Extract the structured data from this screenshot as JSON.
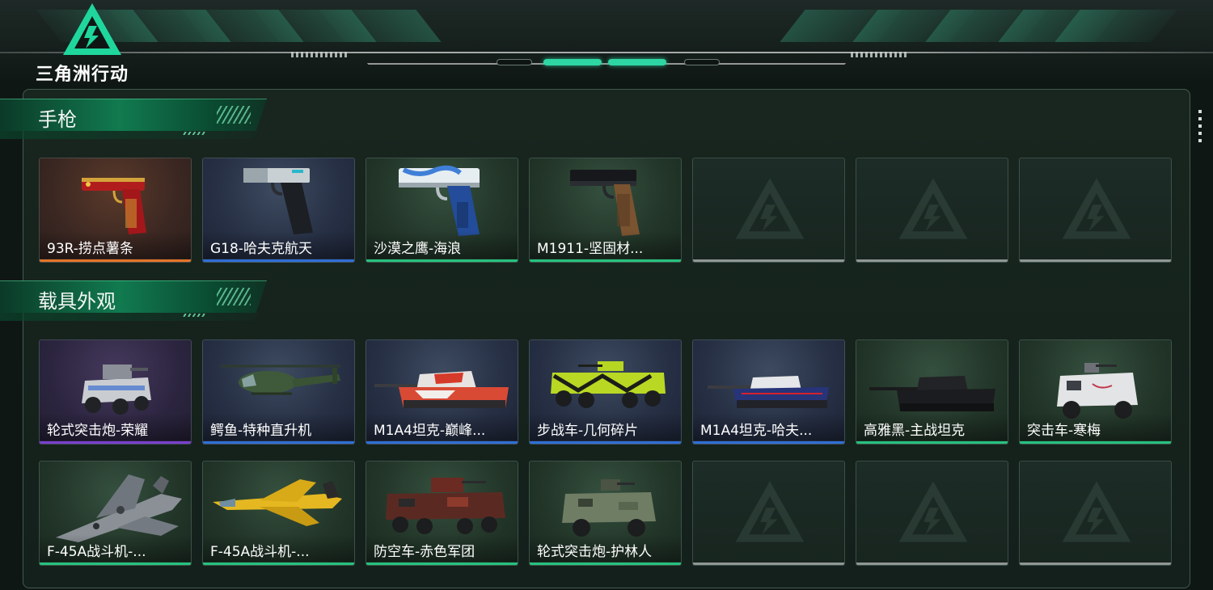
{
  "header": {
    "logo_text": "三角洲行动"
  },
  "sections": [
    {
      "title": "手枪",
      "items": [
        {
          "label": "93R-捞点薯条",
          "rarity": "orange",
          "bg": "orange",
          "icon": "pistol-93r-icon"
        },
        {
          "label": "G18-哈夫克航天",
          "rarity": "blue",
          "bg": "blue",
          "icon": "pistol-g18-icon"
        },
        {
          "label": "沙漠之鹰-海浪",
          "rarity": "green",
          "bg": "green",
          "icon": "pistol-deagle-icon"
        },
        {
          "label": "M1911-坚固材...",
          "rarity": "green",
          "bg": "green",
          "icon": "pistol-m1911-icon"
        }
      ],
      "empty_slots": 3
    },
    {
      "title": "载具外观",
      "items": [
        {
          "label": "轮式突击炮-荣耀",
          "rarity": "purple",
          "bg": "purple",
          "icon": "armored-car-icon"
        },
        {
          "label": "鳄鱼-特种直升机",
          "rarity": "blue",
          "bg": "blue",
          "icon": "helicopter-icon"
        },
        {
          "label": "M1A4坦克-巅峰...",
          "rarity": "blue",
          "bg": "blue",
          "icon": "tank-icon"
        },
        {
          "label": "步战车-几何碎片",
          "rarity": "blue",
          "bg": "blue",
          "icon": "ifv-icon"
        },
        {
          "label": "M1A4坦克-哈夫...",
          "rarity": "blue",
          "bg": "blue",
          "icon": "tank-icon"
        },
        {
          "label": "高雅黑-主战坦克",
          "rarity": "green",
          "bg": "green",
          "icon": "tank-icon"
        },
        {
          "label": "突击车-寒梅",
          "rarity": "green",
          "bg": "green",
          "icon": "assault-vehicle-icon"
        },
        {
          "label": "F-45A战斗机-...",
          "rarity": "green",
          "bg": "green",
          "icon": "fighter-jet-icon"
        },
        {
          "label": "F-45A战斗机-...",
          "rarity": "green",
          "bg": "green",
          "icon": "fighter-jet-icon"
        },
        {
          "label": "防空车-赤色军团",
          "rarity": "green",
          "bg": "green",
          "icon": "aa-vehicle-icon"
        },
        {
          "label": "轮式突击炮-护林人",
          "rarity": "green",
          "bg": "green",
          "icon": "armored-car-icon"
        }
      ],
      "empty_slots": 3
    }
  ],
  "colors": {
    "rarity_orange": "#e3762a",
    "rarity_blue": "#2f6fd6",
    "rarity_green": "#26c27f",
    "rarity_purple": "#7a3fd0",
    "rarity_empty": "#8f9794",
    "accent": "#2ed6a4"
  }
}
